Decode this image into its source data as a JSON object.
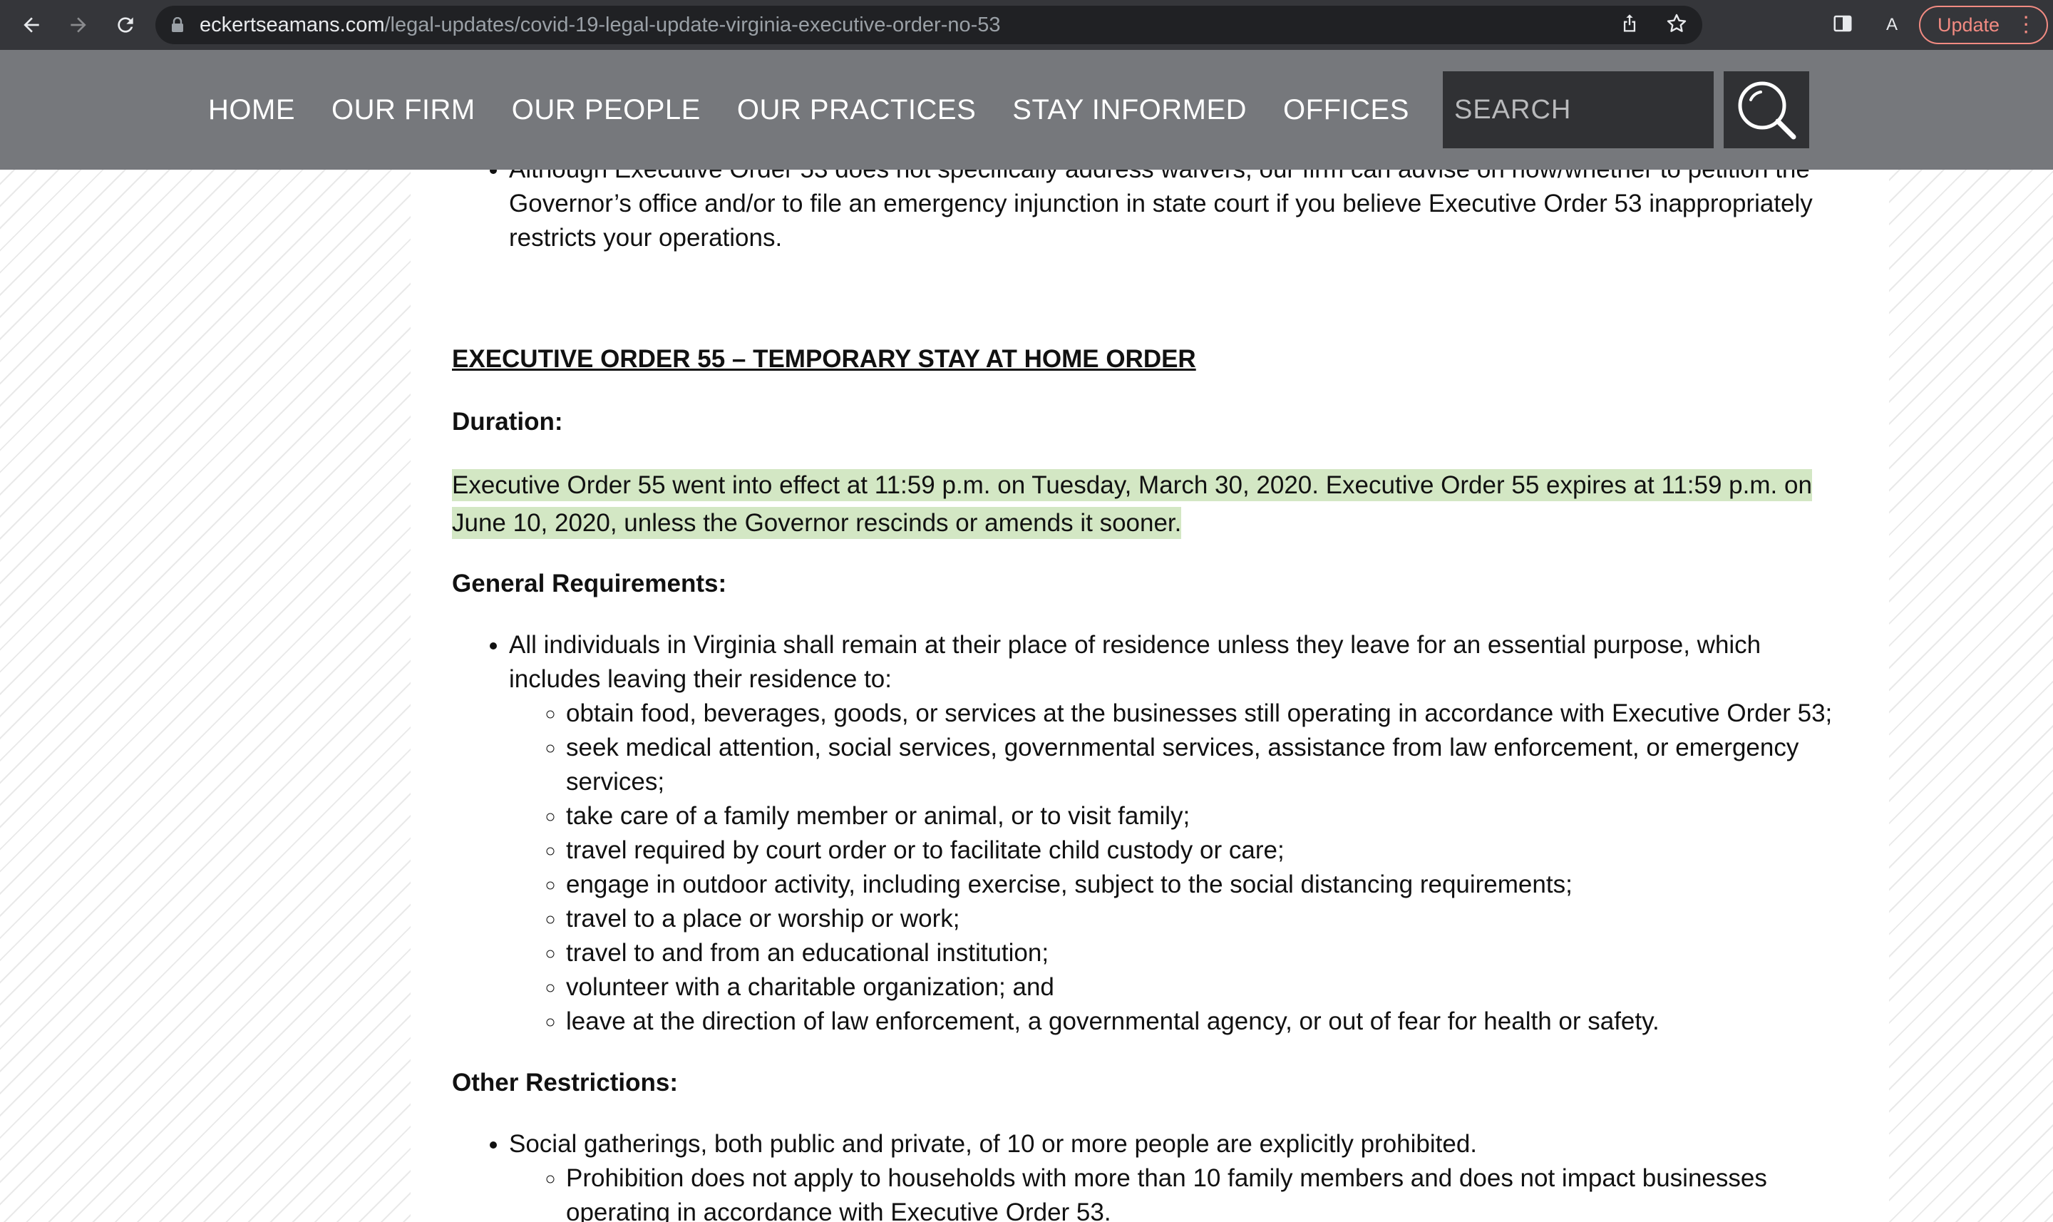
{
  "browser": {
    "url_domain": "eckertseamans.com",
    "url_path": "/legal-updates/covid-19-legal-update-virginia-executive-order-no-53",
    "profile_initial": "A",
    "update_label": "Update"
  },
  "site_nav": {
    "items": [
      {
        "label": "HOME"
      },
      {
        "label": "OUR FIRM"
      },
      {
        "label": "OUR PEOPLE"
      },
      {
        "label": "OUR PRACTICES"
      },
      {
        "label": "STAY INFORMED"
      },
      {
        "label": "OFFICES"
      }
    ],
    "search_placeholder": "SEARCH"
  },
  "article": {
    "intro_bullet": "Although Executive Order 53 does not specifically address waivers, our firm can advise on how/whether to petition the Governor’s office and/or to file an emergency injunction in state court if you believe Executive Order 53 inappropriately restricts your operations.",
    "section_heading": "EXECUTIVE ORDER 55 – TEMPORARY STAY AT HOME ORDER",
    "duration_label": "Duration:",
    "duration_text": "Executive Order 55 went into effect at 11:59 p.m. on Tuesday, March 30, 2020.  Executive Order 55 expires at 11:59 p.m. on June 10, 2020, unless the Governor rescinds or amends it sooner.",
    "general_label": "General Requirements:",
    "general_bullet": "All individuals in Virginia shall remain at their place of residence unless they leave for an essential purpose, which includes leaving their residence to:",
    "general_sub": [
      "obtain food, beverages, goods, or services at the businesses still operating in accordance with Executive Order 53;",
      "seek medical attention, social services, governmental services, assistance from law enforcement, or emergency services;",
      "take care of a family member or animal, or to visit family;",
      "travel required by court order or to facilitate child custody or care;",
      "engage in outdoor activity, including exercise, subject to the social distancing requirements;",
      "travel to a place or worship or work;",
      "travel to and from an educational institution;",
      "volunteer with a charitable organization; and",
      "leave at the direction of law enforcement, a governmental agency, or out of fear for health or safety."
    ],
    "other_label": "Other Restrictions:",
    "other_bullet": "Social gatherings, both public and private, of 10 or more people are explicitly prohibited.",
    "other_sub": [
      "Prohibition does not apply to households with more than 10 family members and does not impact businesses operating in accordance with Executive Order 53."
    ]
  }
}
